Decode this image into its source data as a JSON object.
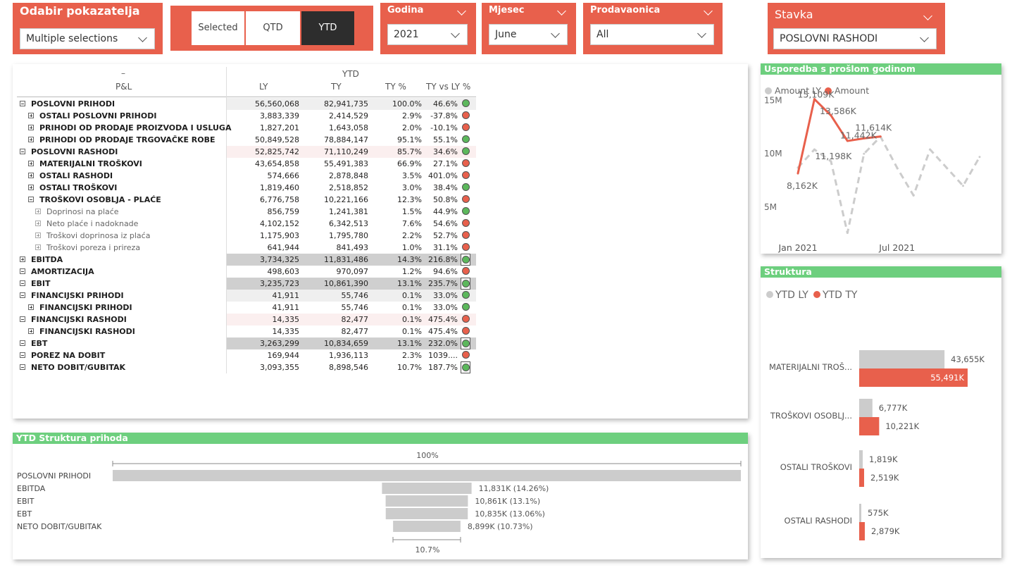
{
  "slicers": {
    "pokazatelj": {
      "title": "Odabir pokazatelja",
      "value": "Multiple selections"
    },
    "period": {
      "options": [
        "Selected",
        "QTD",
        "YTD"
      ],
      "active": "YTD"
    },
    "godina": {
      "title": "Godina",
      "value": "2021"
    },
    "mjesec": {
      "title": "Mjesec",
      "value": "June"
    },
    "prodavaonica": {
      "title": "Prodavaonica",
      "value": "All"
    },
    "stavka": {
      "title": "Stavka",
      "value": "POSLOVNI RASHODI"
    }
  },
  "colors": {
    "accent": "#E8604C",
    "green": "#6DCF7E",
    "grey": "#CCCCCC",
    "dot_green": "#5CB85C",
    "dot_red": "#E8604C"
  },
  "matrix": {
    "dash": "–",
    "group_header": "YTD",
    "row_header": "P&L",
    "columns": [
      "LY",
      "TY",
      "TY %",
      "TY vs LY %"
    ],
    "rows": [
      {
        "label": "POSLOVNI PRIHODI",
        "level": 0,
        "icon": "minus",
        "bold": true,
        "bg": "#EFEFEF",
        "ly": "56,560,068",
        "ty": "82,941,735",
        "typ": "100.0%",
        "vs": "46.6%",
        "dot": "green",
        "boxed": false
      },
      {
        "label": "OSTALI POSLOVNI PRIHODI",
        "level": 1,
        "icon": "plus",
        "bold": false,
        "bg": "",
        "ly": "3,883,339",
        "ty": "2,414,529",
        "typ": "2.9%",
        "vs": "-37.8%",
        "dot": "red",
        "boxed": false
      },
      {
        "label": "PRIHODI OD PRODAJE PROIZVODA I USLUGA",
        "level": 1,
        "icon": "plus",
        "bold": false,
        "bg": "",
        "ly": "1,827,201",
        "ty": "1,643,058",
        "typ": "2.0%",
        "vs": "-10.1%",
        "dot": "red",
        "boxed": false
      },
      {
        "label": "PRIHODI OD PRODAJE TRGOVAČKE ROBE",
        "level": 1,
        "icon": "plus",
        "bold": false,
        "bg": "",
        "ly": "50,849,528",
        "ty": "78,884,147",
        "typ": "95.1%",
        "vs": "55.1%",
        "dot": "green",
        "boxed": false
      },
      {
        "label": "POSLOVNI RASHODI",
        "level": 0,
        "icon": "minus",
        "bold": false,
        "bg": "#FBEFEF",
        "ly": "52,825,742",
        "ty": "71,110,249",
        "typ": "85.7%",
        "vs": "34.6%",
        "dot": "green",
        "boxed": false
      },
      {
        "label": "MATERIJALNI TROŠKOVI",
        "level": 1,
        "icon": "plus",
        "bold": false,
        "bg": "",
        "ly": "43,654,858",
        "ty": "55,491,383",
        "typ": "66.9%",
        "vs": "27.1%",
        "dot": "red",
        "boxed": false
      },
      {
        "label": "OSTALI RASHODI",
        "level": 1,
        "icon": "plus",
        "bold": false,
        "bg": "",
        "ly": "574,666",
        "ty": "2,878,848",
        "typ": "3.5%",
        "vs": "401.0%",
        "dot": "red",
        "boxed": false
      },
      {
        "label": "OSTALI TROŠKOVI",
        "level": 1,
        "icon": "plus",
        "bold": false,
        "bg": "",
        "ly": "1,819,460",
        "ty": "2,518,852",
        "typ": "3.0%",
        "vs": "38.4%",
        "dot": "green",
        "boxed": false
      },
      {
        "label": "TROŠKOVI OSOBLJA - PLAĆE",
        "level": 1,
        "icon": "minus",
        "bold": false,
        "bg": "",
        "ly": "6,776,758",
        "ty": "10,221,166",
        "typ": "12.3%",
        "vs": "50.8%",
        "dot": "red",
        "boxed": false
      },
      {
        "label": "Doprinosi na plaće",
        "level": 2,
        "icon": "plus",
        "bold": false,
        "bg": "",
        "ly": "856,759",
        "ty": "1,241,381",
        "typ": "1.5%",
        "vs": "44.9%",
        "dot": "green",
        "boxed": false
      },
      {
        "label": "Neto plaće i nadoknade",
        "level": 2,
        "icon": "plus",
        "bold": false,
        "bg": "",
        "ly": "4,102,152",
        "ty": "6,342,513",
        "typ": "7.6%",
        "vs": "54.6%",
        "dot": "red",
        "boxed": false
      },
      {
        "label": "Troškovi doprinosa iz plaća",
        "level": 2,
        "icon": "plus",
        "bold": false,
        "bg": "",
        "ly": "1,175,903",
        "ty": "1,795,780",
        "typ": "2.2%",
        "vs": "52.7%",
        "dot": "red",
        "boxed": false
      },
      {
        "label": "Troškovi poreza i prireza",
        "level": 2,
        "icon": "plus",
        "bold": false,
        "bg": "",
        "ly": "641,944",
        "ty": "841,493",
        "typ": "1.0%",
        "vs": "31.1%",
        "dot": "red",
        "boxed": false
      },
      {
        "label": "EBITDA",
        "level": 0,
        "icon": "plus",
        "bold": false,
        "bg": "#CFCFCF",
        "ly": "3,734,325",
        "ty": "11,831,486",
        "typ": "14.3%",
        "vs": "216.8%",
        "dot": "green",
        "boxed": true
      },
      {
        "label": "AMORTIZACIJA",
        "level": 0,
        "icon": "minus",
        "bold": false,
        "bg": "",
        "ly": "498,603",
        "ty": "970,097",
        "typ": "1.2%",
        "vs": "94.6%",
        "dot": "red",
        "boxed": false
      },
      {
        "label": "EBIT",
        "level": 0,
        "icon": "minus",
        "bold": false,
        "bg": "#CFCFCF",
        "ly": "3,235,723",
        "ty": "10,861,390",
        "typ": "13.1%",
        "vs": "235.7%",
        "dot": "green",
        "boxed": true
      },
      {
        "label": "FINANCIJSKI PRIHODI",
        "level": 0,
        "icon": "minus",
        "bold": false,
        "bg": "#EFEFEF",
        "ly": "41,911",
        "ty": "55,746",
        "typ": "0.1%",
        "vs": "33.0%",
        "dot": "green",
        "boxed": false
      },
      {
        "label": "FINANCIJSKI PRIHODI",
        "level": 1,
        "icon": "plus",
        "bold": false,
        "bg": "",
        "ly": "41,911",
        "ty": "55,746",
        "typ": "0.1%",
        "vs": "33.0%",
        "dot": "green",
        "boxed": false
      },
      {
        "label": "FINANCIJSKI RASHODI",
        "level": 0,
        "icon": "minus",
        "bold": false,
        "bg": "#FBEFEF",
        "ly": "14,335",
        "ty": "82,477",
        "typ": "0.1%",
        "vs": "475.4%",
        "dot": "red",
        "boxed": false
      },
      {
        "label": "FINANCIJSKI RASHODI",
        "level": 1,
        "icon": "plus",
        "bold": false,
        "bg": "",
        "ly": "14,335",
        "ty": "82,477",
        "typ": "0.1%",
        "vs": "475.4%",
        "dot": "red",
        "boxed": false
      },
      {
        "label": "EBT",
        "level": 0,
        "icon": "minus",
        "bold": false,
        "bg": "#CFCFCF",
        "ly": "3,263,299",
        "ty": "10,834,659",
        "typ": "13.1%",
        "vs": "232.0%",
        "dot": "green",
        "boxed": true
      },
      {
        "label": "POREZ NA DOBIT",
        "level": 0,
        "icon": "minus",
        "bold": false,
        "bg": "",
        "ly": "169,944",
        "ty": "1,936,113",
        "typ": "2.3%",
        "vs": "1039....",
        "dot": "red",
        "boxed": false
      },
      {
        "label": "NETO DOBIT/GUBITAK",
        "level": 0,
        "icon": "minus",
        "bold": false,
        "bg": "",
        "ly": "3,093,355",
        "ty": "8,898,546",
        "typ": "10.7%",
        "vs": "187.7%",
        "dot": "green",
        "boxed": true
      }
    ]
  },
  "chart_data": [
    {
      "type": "line",
      "title": "Usporedba s prošlom godinom",
      "legend": [
        "Amount LY",
        "Amount"
      ],
      "legend_position": "top-left",
      "x_ticks": [
        "Jan 2021",
        "Jul 2021"
      ],
      "y_ticks": [
        "5M",
        "10M",
        "15M"
      ],
      "ylim": [
        0,
        17000000
      ],
      "grid": false,
      "series": [
        {
          "name": "Amount LY",
          "style": "dashed",
          "color": "#CCCCCC",
          "values": [
            8700000,
            10400000,
            9300000,
            2600000,
            10000000,
            11600000,
            8700000,
            6100000,
            10400000,
            8700000,
            7000000,
            9700000
          ]
        },
        {
          "name": "Amount",
          "style": "solid",
          "color": "#E8604C",
          "values": [
            8162000,
            15109000,
            13586000,
            11198000,
            11442000,
            11614000
          ],
          "labels": [
            "8,162K",
            "15,109K",
            "13,586K",
            "11,198K",
            "11,442K",
            "11,614K"
          ]
        }
      ]
    },
    {
      "type": "bar",
      "orientation": "horizontal",
      "title": "Struktura",
      "legend": [
        "YTD LY",
        "YTD TY"
      ],
      "legend_position": "top-left",
      "categories": [
        "MATERIJALNI TROŠ...",
        "TROŠKOVI OSOBLJ...",
        "OSTALI TROŠKOVI",
        "OSTALI RASHODI"
      ],
      "series": [
        {
          "name": "YTD LY",
          "color": "#CCCCCC",
          "values": [
            43655,
            6777,
            1819,
            575
          ],
          "labels": [
            "43,655K",
            "6,777K",
            "1,819K",
            "575K"
          ]
        },
        {
          "name": "YTD TY",
          "color": "#E8604C",
          "values": [
            55491,
            10221,
            2519,
            2879
          ],
          "labels": [
            "55,491K",
            "10,221K",
            "2,519K",
            "2,879K"
          ]
        }
      ],
      "xlim": [
        0,
        55491
      ]
    },
    {
      "type": "bar",
      "subtype": "funnel",
      "title": "YTD Struktura prihoda",
      "categories": [
        "POSLOVNI PRIHODI",
        "EBITDA",
        "EBIT",
        "EBT",
        "NETO DOBIT/GUBITAK"
      ],
      "values": [
        82941735,
        11831486,
        10861390,
        10834659,
        8898546
      ],
      "labels": [
        "",
        "11,831K (14.26%)",
        "10,861K (13.1%)",
        "10,835K (13.06%)",
        "8,899K (10.73%)"
      ],
      "top_label": "100%",
      "bottom_label": "10.7%",
      "color": "#CCCCCC"
    }
  ]
}
